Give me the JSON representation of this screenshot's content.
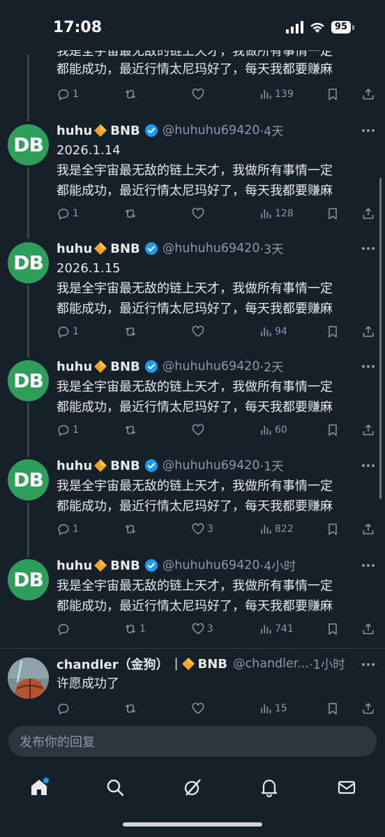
{
  "status_bar": {
    "time": "17:08",
    "battery": "95"
  },
  "author": {
    "name": "huhu",
    "chain": "BNB",
    "handle": "@huhuhu69420",
    "avatar_text": "DB"
  },
  "top_partial": {
    "line1": "我是全宇宙最无敌的链上天才，我做所有事情一定",
    "line2": "都能成功，最近行情太尼玛好了，每天我都要赚麻",
    "replies": "1",
    "retweets": "",
    "likes": "",
    "views": "139"
  },
  "tweets": [
    {
      "time": "·4天",
      "date": "2026.1.14",
      "line1": "我是全宇宙最无敌的链上天才，我做所有事情一定",
      "line2": "都能成功，最近行情太尼玛好了，每天我都要赚麻",
      "replies": "1",
      "retweets": "",
      "likes": "",
      "views": "128"
    },
    {
      "time": "·3天",
      "date": "2026.1.15",
      "line1": "我是全宇宙最无敌的链上天才，我做所有事情一定",
      "line2": "都能成功，最近行情太尼玛好了，每天我都要赚麻",
      "replies": "1",
      "retweets": "",
      "likes": "",
      "views": "94"
    },
    {
      "time": "·2天",
      "date": "",
      "line1": "我是全宇宙最无敌的链上天才，我做所有事情一定",
      "line2": "都能成功，最近行情太尼玛好了，每天我都要赚麻",
      "replies": "1",
      "retweets": "",
      "likes": "",
      "views": "60"
    },
    {
      "time": "·1天",
      "date": "",
      "line1": "我是全宇宙最无敌的链上天才，我做所有事情一定",
      "line2": "都能成功，最近行情太尼玛好了，每天我都要赚麻",
      "replies": "1",
      "retweets": "",
      "likes": "3",
      "views": "822"
    },
    {
      "time": "·4小时",
      "date": "",
      "line1": "我是全宇宙最无敌的链上天才，我做所有事情一定",
      "line2": "都能成功，最近行情太尼玛好了，每天我都要赚麻",
      "replies": "",
      "retweets": "1",
      "likes": "3",
      "views": "741"
    }
  ],
  "reply": {
    "name": "chandler（金狗）",
    "separator": "|",
    "chain": "BNB",
    "handle": "@chandler...",
    "time": "·1小时",
    "text": "许愿成功了",
    "replies": "",
    "retweets": "",
    "likes": "",
    "views": "15"
  },
  "reply_box": {
    "placeholder": "发布你的回复"
  },
  "nav": [
    "home-icon",
    "search-icon",
    "grok-icon",
    "notifications-icon",
    "messages-icon"
  ],
  "colors": {
    "background": "#15202b",
    "accent": "#1d9bf0",
    "verified": "#1d9bf0",
    "bnb": "#f3a326",
    "avatar": "#2f9e5b"
  }
}
